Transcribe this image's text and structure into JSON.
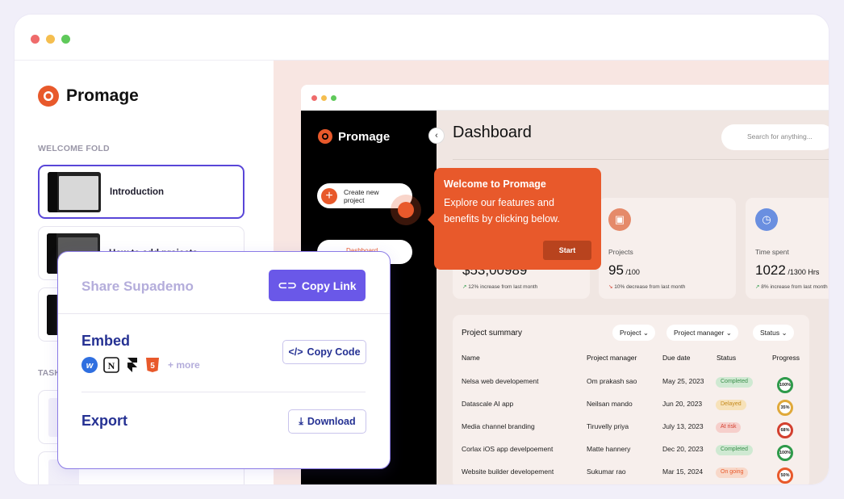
{
  "window": {
    "dots": [
      "#ef6b6b",
      "#f5be4f",
      "#5fc95a"
    ]
  },
  "sidebar": {
    "brand": "Promage",
    "section_label": "WELCOME FOLD",
    "steps": [
      {
        "label": "Introduction",
        "active": true
      },
      {
        "label": "How to add projects",
        "active": false
      }
    ],
    "task_label": "TASK"
  },
  "preview": {
    "brand": "Promage",
    "create_button": "Create new project",
    "dashboard_pill": "Dashboard",
    "title": "Dashboard",
    "search_placeholder": "Search for anything...",
    "tooltip": {
      "title": "Welcome to Promage",
      "body": "Explore our features and benefits by clicking below.",
      "button": "Start"
    },
    "cards": [
      {
        "label": "",
        "value": "$53,00989",
        "suffix": "",
        "note": "12% increase from last month",
        "trend": "up",
        "icon": "dollar-icon",
        "icon_color": "#7c6ce6"
      },
      {
        "label": "Projects",
        "value": "95",
        "suffix": " /100",
        "note": "10% decrease from last month",
        "trend": "down",
        "icon": "briefcase-icon",
        "icon_color": "#e58a6a"
      },
      {
        "label": "Time spent",
        "value": "1022",
        "suffix": " /1300 Hrs",
        "note": "8% increase from last month",
        "trend": "up",
        "icon": "clock-icon",
        "icon_color": "#6a8fe0"
      }
    ],
    "summary": {
      "title": "Project summary",
      "filters": [
        "Project",
        "Project manager",
        "Status"
      ],
      "columns": [
        "Name",
        "Project manager",
        "Due date",
        "Status",
        "Progress"
      ],
      "rows": [
        {
          "name": "Nelsa web developement",
          "manager": "Om prakash sao",
          "due": "May 25, 2023",
          "status": "Completed",
          "progress": "100%",
          "status_bg": "#cfe9d2",
          "status_fg": "#3b8f4c",
          "ring": "#2e9a4a"
        },
        {
          "name": "Datascale AI app",
          "manager": "Neilsan mando",
          "due": "Jun 20, 2023",
          "status": "Delayed",
          "progress": "35%",
          "status_bg": "#f7e2b9",
          "status_fg": "#c58a1c",
          "ring": "#e0a93a"
        },
        {
          "name": "Media channel branding",
          "manager": "Tiruvelly priya",
          "due": "July 13, 2023",
          "status": "At risk",
          "progress": "68%",
          "status_bg": "#f6cfcb",
          "status_fg": "#d3402f",
          "ring": "#d3402f"
        },
        {
          "name": "Corlax iOS app develpoement",
          "manager": "Matte hannery",
          "due": "Dec 20, 2023",
          "status": "Completed",
          "progress": "100%",
          "status_bg": "#cfe9d2",
          "status_fg": "#3b8f4c",
          "ring": "#2e9a4a"
        },
        {
          "name": "Website builder developement",
          "manager": "Sukumar rao",
          "due": "Mar 15, 2024",
          "status": "On going",
          "progress": "50%",
          "status_bg": "#f8d8c9",
          "status_fg": "#e8592b",
          "ring": "#e8592b"
        }
      ]
    }
  },
  "share": {
    "title": "Share Supademo",
    "copy_link": "Copy Link",
    "embed_title": "Embed",
    "embed_more": "+ more",
    "copy_code": "Copy Code",
    "export_title": "Export",
    "download": "Download"
  }
}
